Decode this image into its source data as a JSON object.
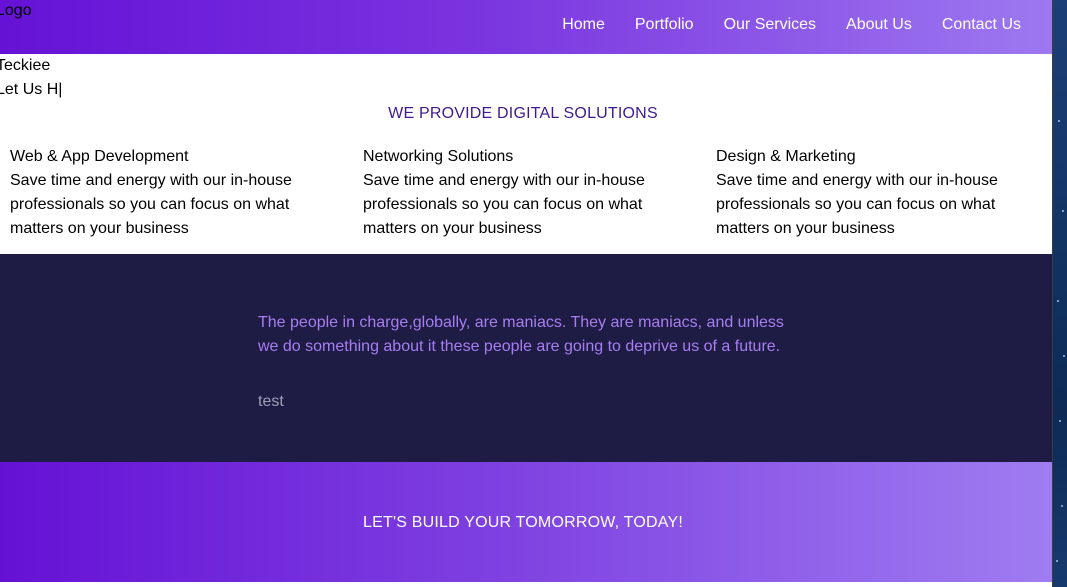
{
  "header": {
    "logo": "Logo",
    "nav": [
      {
        "label": "Home"
      },
      {
        "label": "Portfolio"
      },
      {
        "label": "Our Services"
      },
      {
        "label": "About Us"
      },
      {
        "label": "Contact Us"
      }
    ]
  },
  "hero": {
    "brand": "Teckiee",
    "typing": "Let Us H|"
  },
  "services_section": {
    "title": "WE PROVIDE DIGITAL SOLUTIONS",
    "items": [
      {
        "title": "Web & App Development",
        "description": "Save time and energy with our in-house professionals so you can focus on what matters on your business"
      },
      {
        "title": "Networking Solutions",
        "description": "Save time and energy with our in-house professionals so you can focus on what matters on your business"
      },
      {
        "title": "Design & Marketing",
        "description": "Save time and energy with our in-house professionals so you can focus on what matters on your business"
      }
    ]
  },
  "quote": {
    "text": "The people in charge,globally, are maniacs. They are maniacs, and unless we do something about it these people are going to deprive us of a future.",
    "author": "test"
  },
  "cta": {
    "text": "LET'S BUILD YOUR TOMORROW, TODAY!"
  },
  "colors": {
    "header_gradient_start": "#6512d6",
    "header_gradient_end": "#9d78f0",
    "section_title": "#3e1a8c",
    "quote_background": "#1e1b45",
    "quote_text": "#a77ef0",
    "quote_author": "#9a9fb5"
  }
}
